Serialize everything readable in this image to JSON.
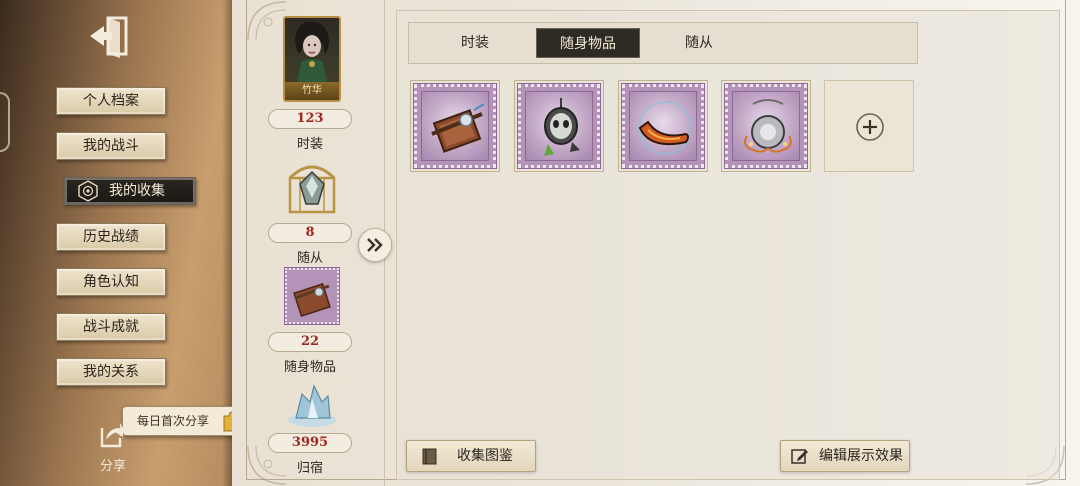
{
  "sidebar": {
    "items": [
      {
        "label": "个人档案"
      },
      {
        "label": "我的战斗"
      },
      {
        "label": "我的收集"
      },
      {
        "label": "历史战绩"
      },
      {
        "label": "角色认知"
      },
      {
        "label": "战斗成就"
      },
      {
        "label": "我的关系"
      }
    ],
    "active_index": 2,
    "share_tip": "每日首次分享",
    "share_label": "分享"
  },
  "summary": {
    "portrait_name": "竹华",
    "costume_count": "123",
    "costume_label": "时装",
    "companion_count": "8",
    "companion_label": "随从",
    "accessory_count": "22",
    "accessory_label": "随身物品",
    "home_count": "3995",
    "home_label": "归宿"
  },
  "tabs": [
    {
      "label": "时装"
    },
    {
      "label": "随身物品"
    },
    {
      "label": "随从"
    }
  ],
  "active_tab": 1,
  "items": [
    {
      "icon": "book-crossbow-icon"
    },
    {
      "icon": "skull-lantern-icon"
    },
    {
      "icon": "boomerang-icon"
    },
    {
      "icon": "silver-ornament-icon"
    }
  ],
  "buttons": {
    "collection_catalog": "收集图鉴",
    "edit_display": "编辑展示效果"
  },
  "colors": {
    "count_red": "#a1281f",
    "stamp_purple": "#b493b8",
    "active_tab_dark": "#2e2a24"
  }
}
